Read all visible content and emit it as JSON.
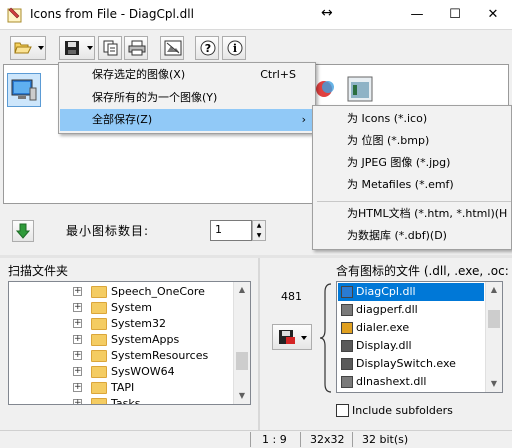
{
  "window": {
    "title": "Icons from File - DiagCpl.dll",
    "resize_glyph": "↔",
    "minimize_glyph": "—",
    "maximize_glyph": "☐",
    "close_glyph": "✕"
  },
  "toolbar": {
    "buttons": [
      "open-folder-icon",
      "save-disk-icon",
      "copy-icon",
      "print-icon",
      "image-view-icon",
      "help-icon",
      "info-icon"
    ]
  },
  "context_menu": {
    "items": [
      {
        "label": "保存选定的图像(X)",
        "shortcut": "Ctrl+S"
      },
      {
        "label": "保存所有的为一个图像(Y)",
        "shortcut": ""
      },
      {
        "label": "全部保存(Z)",
        "shortcut": "",
        "submenu_arrow": "›"
      }
    ]
  },
  "submenu": {
    "items": [
      "为 Icons (*.ico)",
      "为 位图 (*.bmp)",
      "为 JPEG 图像 (*.jpg)",
      "为 Metafiles (*.emf)",
      "为HTML文档 (*.htm, *.html)(H",
      "为数据库 (*.dbf)(D)"
    ]
  },
  "controls": {
    "min_icon_label": "最小图标数目:",
    "min_icon_value": "1",
    "spin_up": "▲",
    "spin_down": "▼"
  },
  "scan": {
    "label": "扫描文件夹",
    "expander": "+",
    "folders": [
      "Speech_OneCore",
      "System",
      "System32",
      "SystemApps",
      "SystemResources",
      "SysWOW64",
      "TAPI",
      "Tasks"
    ]
  },
  "files_panel": {
    "label": "含有图标的文件 (.dll, .exe, .oc:",
    "count": "481",
    "files": [
      "DiagCpl.dll",
      "diagperf.dll",
      "dialer.exe",
      "Display.dll",
      "DisplaySwitch.exe",
      "dlnashext.dll"
    ],
    "include_subfolders_label": "Include subfolders"
  },
  "status": {
    "position": "1 : 9",
    "size": "32x32",
    "bits": "32 bit(s)"
  }
}
